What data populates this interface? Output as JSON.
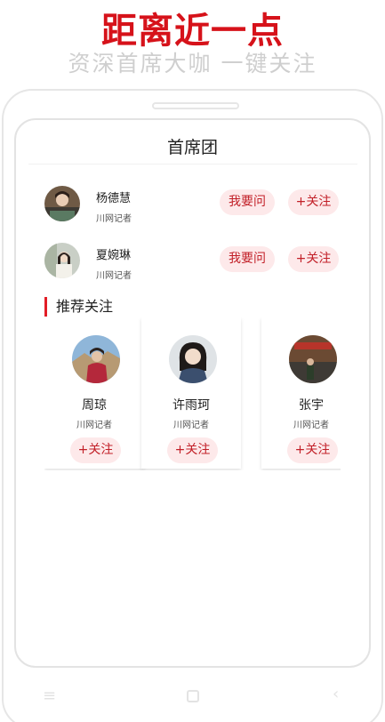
{
  "promo": {
    "headline": "距离近一点",
    "subline": "资深首席大咖 一键关注"
  },
  "page": {
    "title": "首席团"
  },
  "members": [
    {
      "name": "杨德慧",
      "role": "川网记者",
      "ask_label": "我要问",
      "follow_label": "+关注"
    },
    {
      "name": "夏婉琳",
      "role": "川网记者",
      "ask_label": "我要问",
      "follow_label": "+关注"
    }
  ],
  "recommend": {
    "title": "推荐关注",
    "cards": [
      {
        "name": "周琼",
        "role": "川网记者",
        "follow_label": "+关注"
      },
      {
        "name": "许雨珂",
        "role": "川网记者",
        "follow_label": "+关注"
      },
      {
        "name": "张宇",
        "role": "川网记者",
        "follow_label": "+关注"
      }
    ]
  },
  "colors": {
    "accent": "#d6121a",
    "pill_bg": "#fde9ea",
    "pill_text": "#c22028"
  },
  "nav_icons": [
    "menu-icon",
    "home-square-icon",
    "back-chevron-icon"
  ]
}
